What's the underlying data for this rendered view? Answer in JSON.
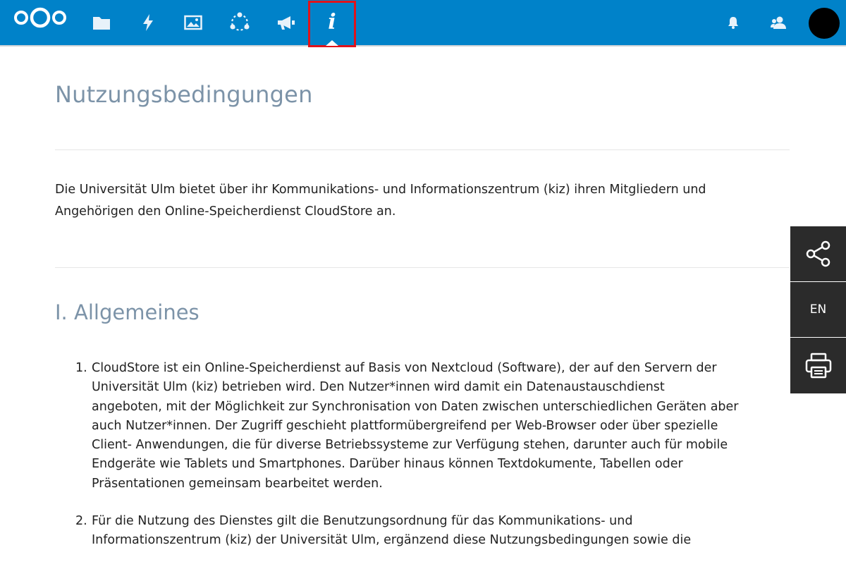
{
  "topbar": {
    "brand_color": "#0082c9",
    "nav_icons": [
      "files-icon",
      "activity-icon",
      "photos-icon",
      "circles-icon",
      "announcements-icon",
      "info-icon"
    ],
    "active_nav": "info-icon",
    "active_label": "i",
    "right_icons": [
      "notifications-icon",
      "contacts-icon",
      "avatar"
    ]
  },
  "page": {
    "title": "Nutzungsbedingungen",
    "intro_line1": "Die Universität Ulm bietet über ihr Kommunikations- und Informationszentrum (kiz) ihren Mitgliedern und",
    "intro_line2": "Angehörigen den Online-Speicherdienst CloudStore an.",
    "section_title": "I. Allgemeines",
    "items": [
      {
        "number": "1.",
        "lines": [
          "CloudStore ist ein Online-Speicherdienst auf Basis von Nextcloud (Software), der auf den Servern der",
          "Universität Ulm (kiz) betrieben wird. Den Nutzer*innen wird damit ein Datenaustauschdienst",
          "angeboten, mit der Möglichkeit zur Synchronisation von Daten zwischen unterschiedlichen Geräten aber",
          "auch Nutzer*innen. Der Zugriff geschieht plattformübergreifend per Web-Browser oder über spezielle",
          "Client- Anwendungen, die für diverse Betriebssysteme zur Verfügung stehen, darunter auch für mobile",
          "Endgeräte wie Tablets und Smartphones. Darüber hinaus können Textdokumente, Tabellen oder",
          "Präsentationen gemeinsam bearbeitet werden."
        ]
      },
      {
        "number": "2.",
        "lines": [
          "Für die Nutzung des Dienstes gilt die Benutzungsordnung für das Kommunikations- und",
          "Informationszentrum (kiz) der Universität Ulm, ergänzend diese Nutzungsbedingungen sowie die"
        ]
      }
    ]
  },
  "side_toolbar": {
    "share_icon": "share-icon",
    "language_label": "EN",
    "print_icon": "print-icon",
    "bg_color": "#2b2b2b"
  }
}
